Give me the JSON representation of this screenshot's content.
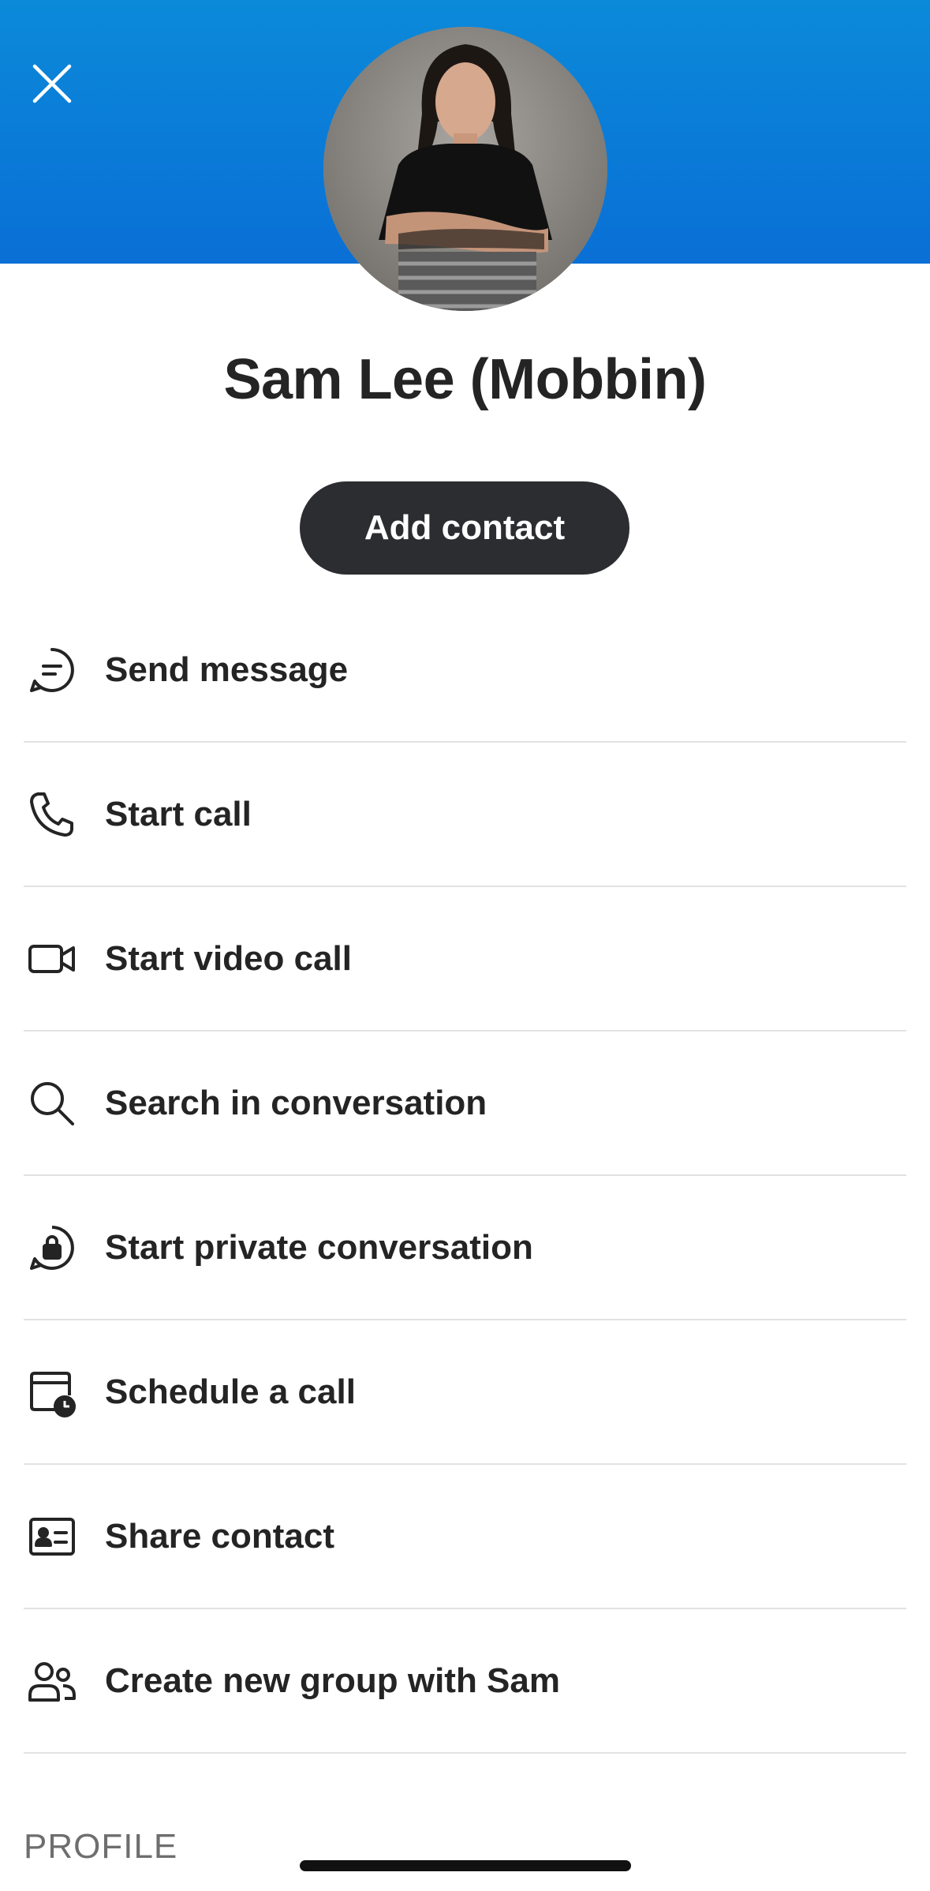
{
  "header": {
    "close_icon": "close-icon",
    "background_color": "#0a7ed8"
  },
  "profile": {
    "name": "Sam Lee (Mobbin)",
    "avatar": "avatar-photo",
    "add_contact_label": "Add contact"
  },
  "actions": [
    {
      "label": "Send message",
      "icon": "chat-bubble-icon"
    },
    {
      "label": "Start call",
      "icon": "phone-icon"
    },
    {
      "label": "Start video call",
      "icon": "video-camera-icon"
    },
    {
      "label": "Search in conversation",
      "icon": "search-icon"
    },
    {
      "label": "Start private conversation",
      "icon": "lock-chat-icon"
    },
    {
      "label": "Schedule a call",
      "icon": "calendar-clock-icon"
    },
    {
      "label": "Share contact",
      "icon": "contact-card-icon"
    },
    {
      "label": "Create new group with Sam",
      "icon": "people-icon"
    }
  ],
  "section": {
    "profile_label": "PROFILE"
  }
}
